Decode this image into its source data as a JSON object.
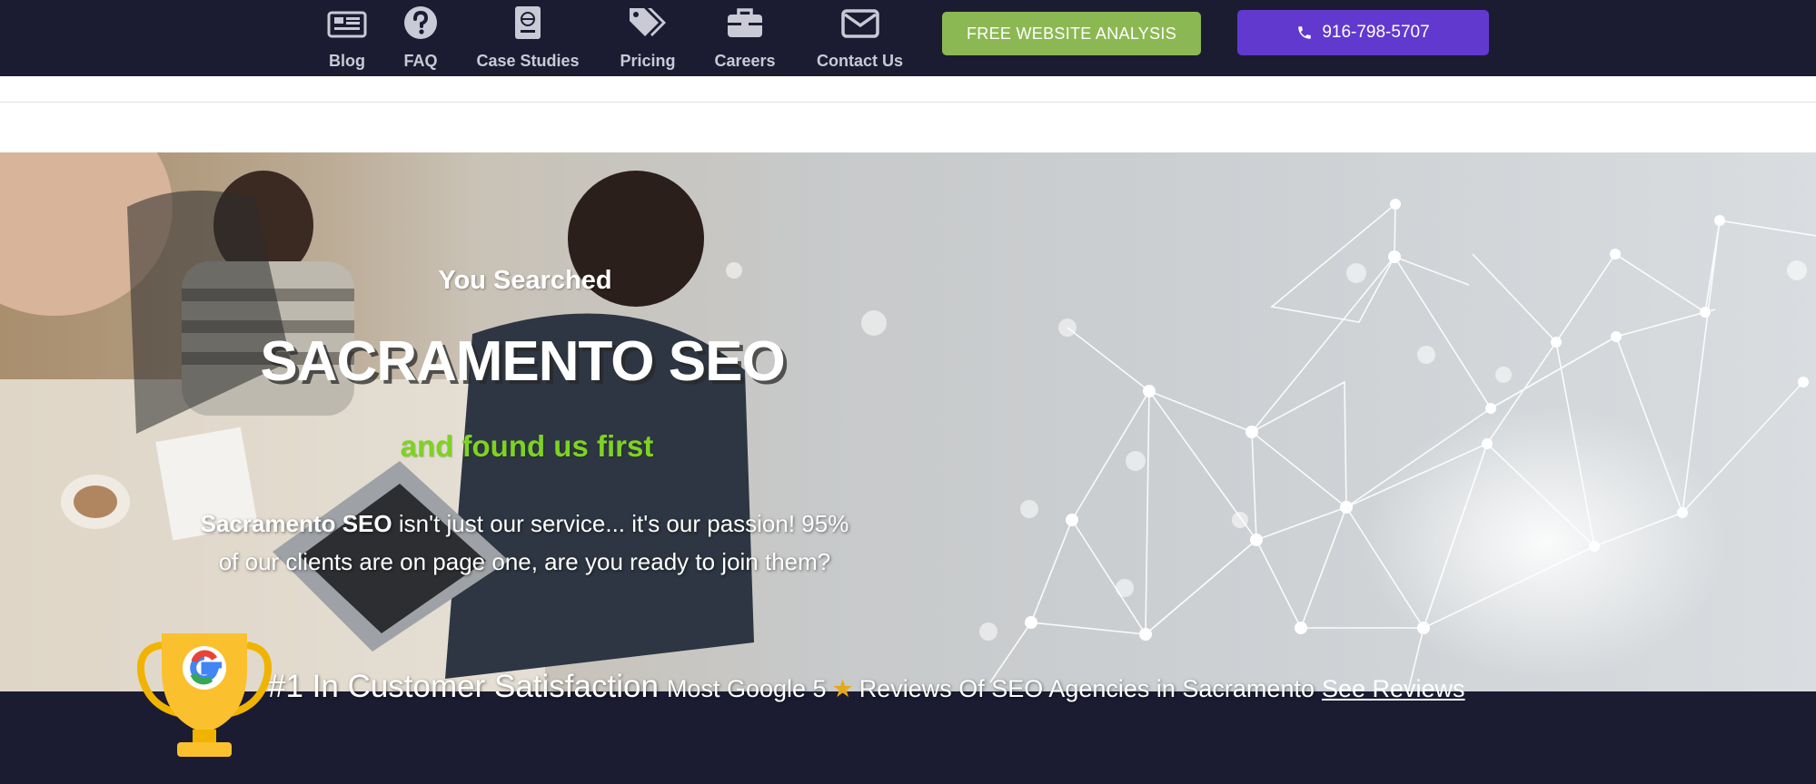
{
  "nav": {
    "items": [
      {
        "label": "Blog",
        "icon": "newspaper-icon"
      },
      {
        "label": "FAQ",
        "icon": "question-circle-icon"
      },
      {
        "label": "Case Studies",
        "icon": "passport-book-icon"
      },
      {
        "label": "Pricing",
        "icon": "price-tags-icon"
      },
      {
        "label": "Careers",
        "icon": "briefcase-icon"
      },
      {
        "label": "Contact Us",
        "icon": "envelope-icon"
      }
    ],
    "cta_label": "FREE WEBSITE ANALYSIS",
    "phone_label": "916-798-5707"
  },
  "hero": {
    "eyebrow": "You Searched",
    "headline": "SACRAMENTO SEO",
    "subhead": "and found us first",
    "blurb_strong": "Sacramento SEO",
    "blurb_rest": " isn't just our service... it's our passion! 95% of our clients are on page one, are you ready to join them?"
  },
  "satisfaction": {
    "title": "#1 In Customer Satisfaction",
    "subtitle_before": "Most Google 5",
    "star": "★",
    "subtitle_after": "Reviews Of SEO Agencies in Sacramento",
    "link_label": "See Reviews"
  },
  "colors": {
    "nav_bg": "#1b1c32",
    "cta_green": "#8cb853",
    "phone_purple": "#6139cf",
    "accent_green": "#7ed321",
    "star_gold": "#e6a817"
  }
}
